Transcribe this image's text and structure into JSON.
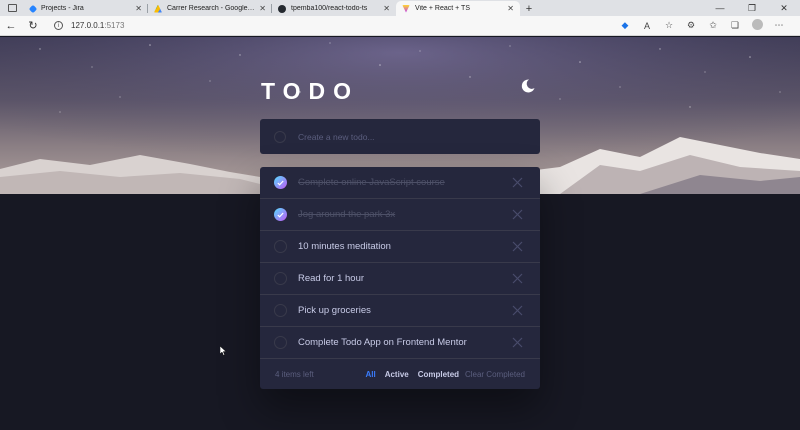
{
  "browser": {
    "tabs": [
      {
        "title": "Projects - Jira",
        "color": "#2684ff",
        "active": false
      },
      {
        "title": "Carrer Research - Google Drive",
        "color": "#0f9d58",
        "active": false
      },
      {
        "title": "tpemba100/react-todo-ts",
        "color": "#24292f",
        "active": false
      },
      {
        "title": "Vite + React + TS",
        "color": "#bd34fe",
        "active": true
      }
    ],
    "new_tab_icon": "plus-icon",
    "address": {
      "host": "127.0.0.1",
      "port": ":5173"
    }
  },
  "app": {
    "title": "TODO",
    "theme_icon": "moon-icon",
    "new_todo_placeholder": "Create a new todo...",
    "todos": [
      {
        "text": "Complete online JavaScript course",
        "completed": true
      },
      {
        "text": "Jog around the park 3x",
        "completed": true
      },
      {
        "text": "10 minutes meditation",
        "completed": false
      },
      {
        "text": "Read for 1 hour",
        "completed": false
      },
      {
        "text": "Pick up groceries",
        "completed": false
      },
      {
        "text": "Complete Todo App on Frontend Mentor",
        "completed": false
      }
    ],
    "footer": {
      "items_left": "4 items left",
      "filters": [
        {
          "label": "All",
          "selected": true
        },
        {
          "label": "Active",
          "selected": false
        },
        {
          "label": "Completed",
          "selected": false
        }
      ],
      "clear_label": "Clear Completed"
    }
  },
  "colors": {
    "background": "#171823",
    "card": "#25273d",
    "text": "#c8cbe7",
    "accent": "#3a7cfd",
    "check_gradient_start": "#55ddff",
    "check_gradient_end": "#c058f3"
  }
}
